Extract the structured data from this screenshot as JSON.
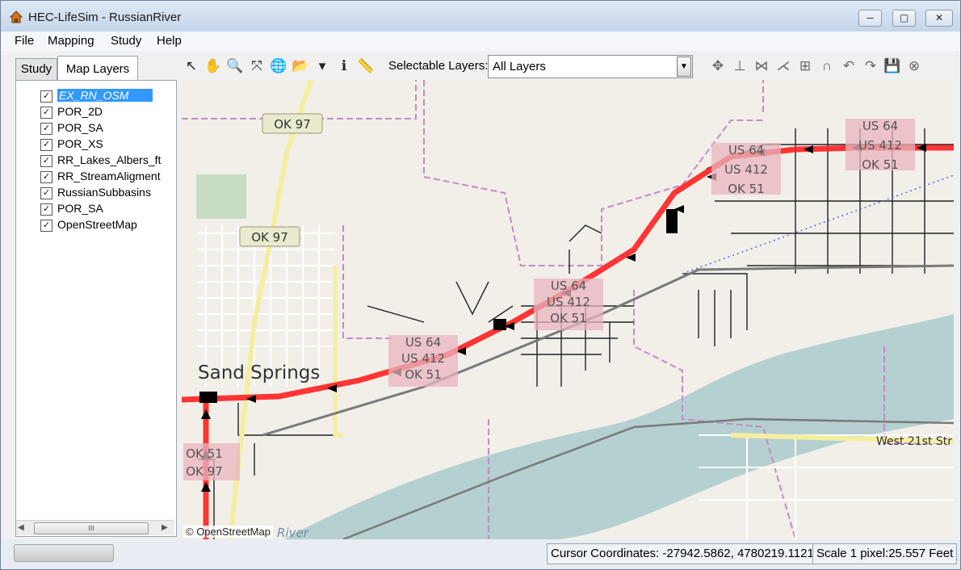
{
  "window": {
    "title": "HEC-LifeSim - RussianRiver",
    "min": "─",
    "max": "▢",
    "close": "✕"
  },
  "menu": [
    "File",
    "Mapping",
    "Study",
    "Help"
  ],
  "tabs": {
    "study": "Study",
    "layers": "Map Layers"
  },
  "layers": [
    {
      "label": "EX_RN_OSM",
      "checked": true,
      "selected": true
    },
    {
      "label": "POR_2D",
      "checked": true
    },
    {
      "label": "POR_SA",
      "checked": true
    },
    {
      "label": "POR_XS",
      "checked": true
    },
    {
      "label": "RR_Lakes_Albers_ft",
      "checked": true
    },
    {
      "label": "RR_StreamAligment",
      "checked": true
    },
    {
      "label": "RussianSubbasins",
      "checked": true
    },
    {
      "label": "POR_SA",
      "checked": true
    },
    {
      "label": "OpenStreetMap",
      "checked": true
    }
  ],
  "checkmark": "✓",
  "scrollbar": {
    "left": "◀",
    "thumb": "III",
    "right": "▶"
  },
  "tools": [
    {
      "icon": "select-arrow-icon",
      "glyph": "↖"
    },
    {
      "icon": "pan-hand-icon",
      "glyph": "✋"
    },
    {
      "icon": "zoom-in-icon",
      "glyph": "🔍"
    },
    {
      "icon": "full-extent-icon",
      "glyph": "⤧"
    },
    {
      "icon": "globe-icon",
      "glyph": "🌐"
    },
    {
      "icon": "add-layer-icon",
      "glyph": "📂"
    },
    {
      "icon": "dropdown-icon",
      "glyph": "▾"
    },
    {
      "icon": "info-icon",
      "glyph": "ℹ"
    },
    {
      "icon": "measure-icon",
      "glyph": "📏"
    }
  ],
  "selectable_layers": {
    "label": "Selectable Layers:",
    "value": "All Layers",
    "arrow": "▼"
  },
  "edit_tools": [
    {
      "icon": "move-icon",
      "glyph": "✥"
    },
    {
      "icon": "add-vertex-icon",
      "glyph": "⊥"
    },
    {
      "icon": "split-icon",
      "glyph": "⋈"
    },
    {
      "icon": "reshape-icon",
      "glyph": "⋌"
    },
    {
      "icon": "merge-icon",
      "glyph": "⊞"
    },
    {
      "icon": "magnet-icon",
      "glyph": "∩"
    },
    {
      "icon": "undo-icon",
      "glyph": "↶"
    },
    {
      "icon": "redo-icon",
      "glyph": "↷"
    },
    {
      "icon": "save-icon",
      "glyph": "💾"
    },
    {
      "icon": "cancel-icon",
      "glyph": "⊗"
    }
  ],
  "map": {
    "city": "Sand Springs",
    "river_label": "River",
    "street": "West 21st Str",
    "shields": [
      {
        "lines": [
          "OK 97"
        ]
      },
      {
        "lines": [
          "OK 97"
        ]
      },
      {
        "lines": [
          "US 64",
          "US 412",
          "OK 51"
        ]
      },
      {
        "lines": [
          "US 64",
          "US 412",
          "OK 51"
        ]
      },
      {
        "lines": [
          "US 64",
          "US 412",
          "OK 51"
        ]
      },
      {
        "lines": [
          "US 64",
          "US 412",
          "OK 51"
        ]
      },
      {
        "lines": [
          "OK 51",
          "OK 97"
        ]
      }
    ],
    "attribution": "© OpenStreetMap"
  },
  "status": {
    "cursor": "Cursor Coordinates: -27942.5862, 4780219.1121",
    "scale": "Scale 1 pixel:25.557 Feet"
  }
}
